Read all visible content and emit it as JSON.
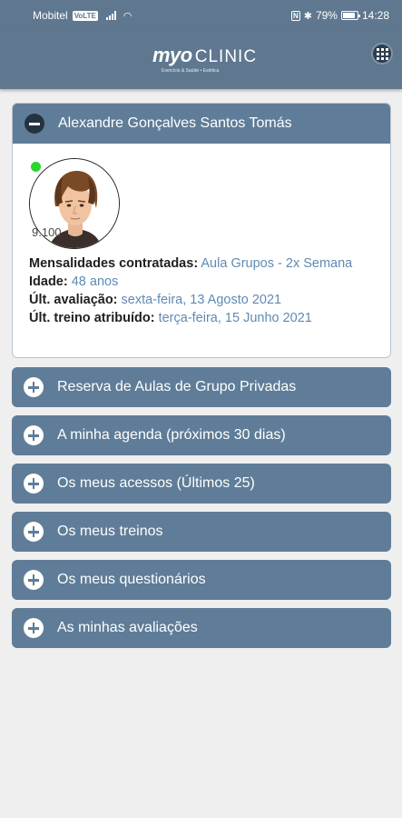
{
  "status_bar": {
    "carrier": "Mobitel",
    "volte": "VoLTE",
    "nfc": "N",
    "battery": "79%",
    "time": "14:28"
  },
  "header": {
    "logo_myo": "myo",
    "logo_clinic": "CLINIC",
    "logo_tagline": "Exercício & Saúde • Estética",
    "grid_icon": "grid-icon"
  },
  "profile": {
    "name": "Alexandre Gonçalves Santos Tomás",
    "avatar_code": "9.100",
    "online_color": "#29d62c",
    "fields": [
      {
        "label": "Mensalidades contratadas:",
        "value": "Aula Grupos - 2x Semana"
      },
      {
        "label": "Idade:",
        "value": "48 anos"
      },
      {
        "label": "Últ. avaliação:",
        "value": "sexta-feira, 13 Agosto 2021"
      },
      {
        "label": "Últ. treino atribuído:",
        "value": "terça-feira, 15 Junho 2021"
      }
    ]
  },
  "sections": [
    {
      "label": "Reserva de Aulas de Grupo Privadas"
    },
    {
      "label": "A minha agenda (próximos 30 dias)"
    },
    {
      "label": "Os meus acessos (Últimos 25)"
    },
    {
      "label": "Os meus treinos"
    },
    {
      "label": "Os meus questionários"
    },
    {
      "label": "As minhas avaliações"
    }
  ],
  "colors": {
    "header_bg": "#5f7890",
    "panel_bg": "#5f7d98",
    "link": "#5f8ab2"
  }
}
